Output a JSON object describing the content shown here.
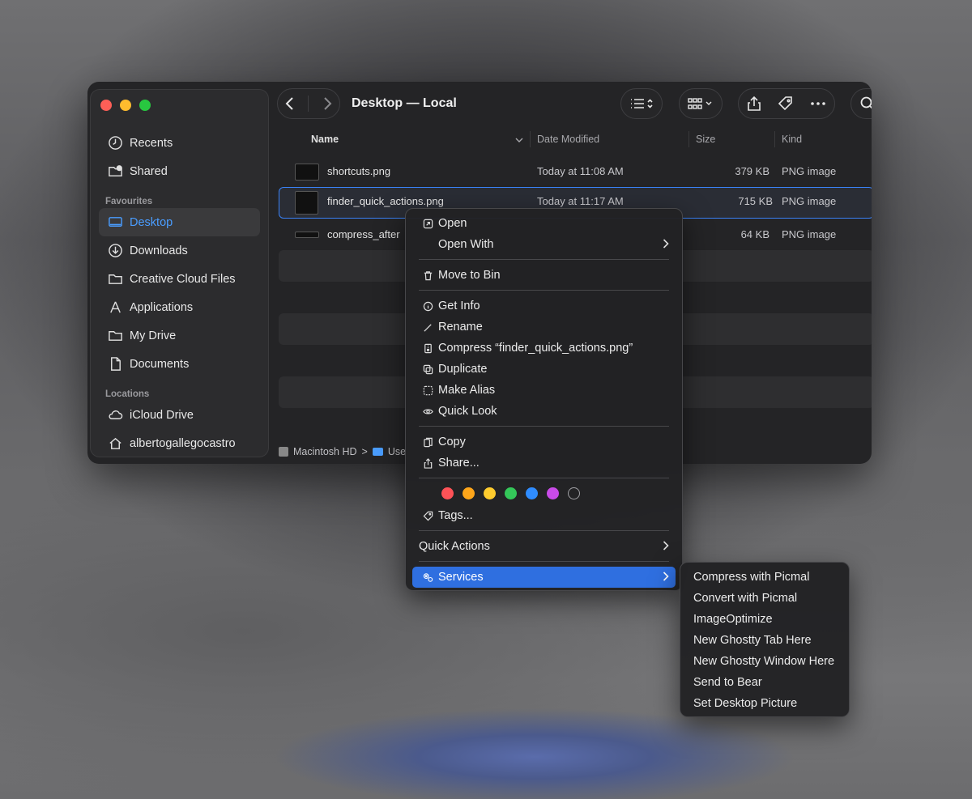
{
  "window": {
    "title": "Desktop — Local"
  },
  "sidebar": {
    "top_items": [
      {
        "label": "Recents",
        "icon": "clock-icon"
      },
      {
        "label": "Shared",
        "icon": "shared-folder-icon"
      }
    ],
    "favourites_heading": "Favourites",
    "favourites": [
      {
        "label": "Desktop",
        "icon": "desktop-icon",
        "active": true
      },
      {
        "label": "Downloads",
        "icon": "download-icon"
      },
      {
        "label": "Creative Cloud Files",
        "icon": "folder-icon"
      },
      {
        "label": "Applications",
        "icon": "applications-icon"
      },
      {
        "label": "My Drive",
        "icon": "folder-icon"
      },
      {
        "label": "Documents",
        "icon": "document-icon"
      }
    ],
    "locations_heading": "Locations",
    "locations": [
      {
        "label": "iCloud Drive",
        "icon": "cloud-icon"
      },
      {
        "label": "albertogallegocastro",
        "icon": "home-icon"
      }
    ]
  },
  "columns": {
    "name": "Name",
    "date": "Date Modified",
    "size": "Size",
    "kind": "Kind"
  },
  "files": [
    {
      "name": "shortcuts.png",
      "date": "Today at 11:08 AM",
      "size": "379 KB",
      "kind": "PNG image"
    },
    {
      "name": "finder_quick_actions.png",
      "date": "Today at 11:17 AM",
      "size": "715 KB",
      "kind": "PNG image",
      "selected": true
    },
    {
      "name": "compress_after",
      "date": "",
      "size": "64 KB",
      "kind": "PNG image"
    }
  ],
  "pathbar": {
    "disk": "Macintosh HD",
    "separator": ">",
    "folder": "Use"
  },
  "context_menu": {
    "open": "Open",
    "open_with": "Open With",
    "move_to_bin": "Move to Bin",
    "get_info": "Get Info",
    "rename": "Rename",
    "compress": "Compress “finder_quick_actions.png”",
    "duplicate": "Duplicate",
    "make_alias": "Make Alias",
    "quick_look": "Quick Look",
    "copy": "Copy",
    "share": "Share...",
    "tag_colors": [
      "#ff5257",
      "#ffa61a",
      "#ffcc2e",
      "#34c759",
      "#2f8cff",
      "#c94be8"
    ],
    "tags": "Tags...",
    "quick_actions": "Quick Actions",
    "services": "Services"
  },
  "services_submenu": [
    "Compress with Picmal",
    "Convert with Picmal",
    "ImageOptimize",
    "New Ghostty Tab Here",
    "New Ghostty Window Here",
    "Send to Bear",
    "Set Desktop Picture"
  ]
}
